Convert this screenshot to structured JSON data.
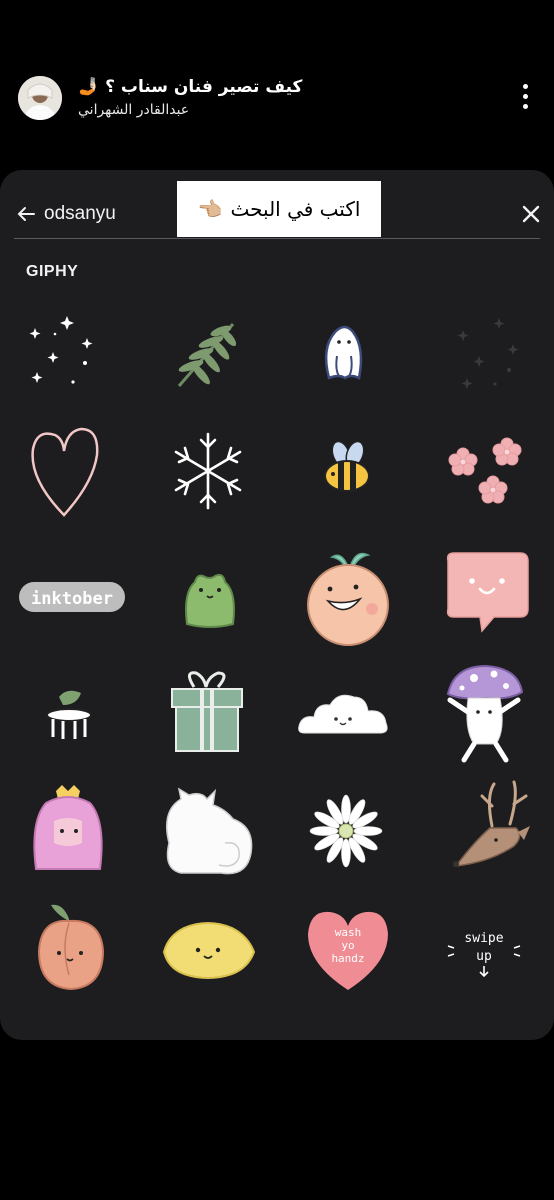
{
  "story": {
    "title": "كيف تصير فنان سناب ؟ 🤳🏻",
    "author": "عبدالقادر الشهراني"
  },
  "search": {
    "query": "odsanyu",
    "overlay_text": "اكتب في البحث",
    "overlay_emoji": "👈🏼"
  },
  "section_label": "GIPHY",
  "stickers": [
    {
      "name": "sparkles",
      "row": 1,
      "col": 1
    },
    {
      "name": "fern-leaf",
      "row": 1,
      "col": 2
    },
    {
      "name": "ghost-bunny",
      "row": 1,
      "col": 3
    },
    {
      "name": "faint-sparkles",
      "row": 1,
      "col": 4
    },
    {
      "name": "heart-outline",
      "row": 2,
      "col": 1
    },
    {
      "name": "snowflake",
      "row": 2,
      "col": 2
    },
    {
      "name": "bee",
      "row": 2,
      "col": 3
    },
    {
      "name": "pink-flowers",
      "row": 2,
      "col": 4
    },
    {
      "name": "inktober",
      "row": 3,
      "col": 1,
      "text": "inktober"
    },
    {
      "name": "green-frog",
      "row": 3,
      "col": 2
    },
    {
      "name": "peach-creature",
      "row": 3,
      "col": 3
    },
    {
      "name": "speech-bubble",
      "row": 3,
      "col": 4
    },
    {
      "name": "tiny-stool",
      "row": 4,
      "col": 1
    },
    {
      "name": "gift-box",
      "row": 4,
      "col": 2
    },
    {
      "name": "cloud",
      "row": 4,
      "col": 3
    },
    {
      "name": "mushroom",
      "row": 4,
      "col": 4
    },
    {
      "name": "princess-bubblegum",
      "row": 5,
      "col": 1
    },
    {
      "name": "white-cat",
      "row": 5,
      "col": 2
    },
    {
      "name": "daisy",
      "row": 5,
      "col": 3
    },
    {
      "name": "deer",
      "row": 5,
      "col": 4
    },
    {
      "name": "peach",
      "row": 6,
      "col": 1
    },
    {
      "name": "lemon",
      "row": 6,
      "col": 2
    },
    {
      "name": "heart-wash-hands",
      "row": 6,
      "col": 3,
      "text": "wash yo handz"
    },
    {
      "name": "swipe-up",
      "row": 6,
      "col": 4,
      "text": "swipe up"
    }
  ],
  "colors": {
    "background": "#000000",
    "panel": "#1d1d1f",
    "accent_pink": "#f2b8b5"
  }
}
